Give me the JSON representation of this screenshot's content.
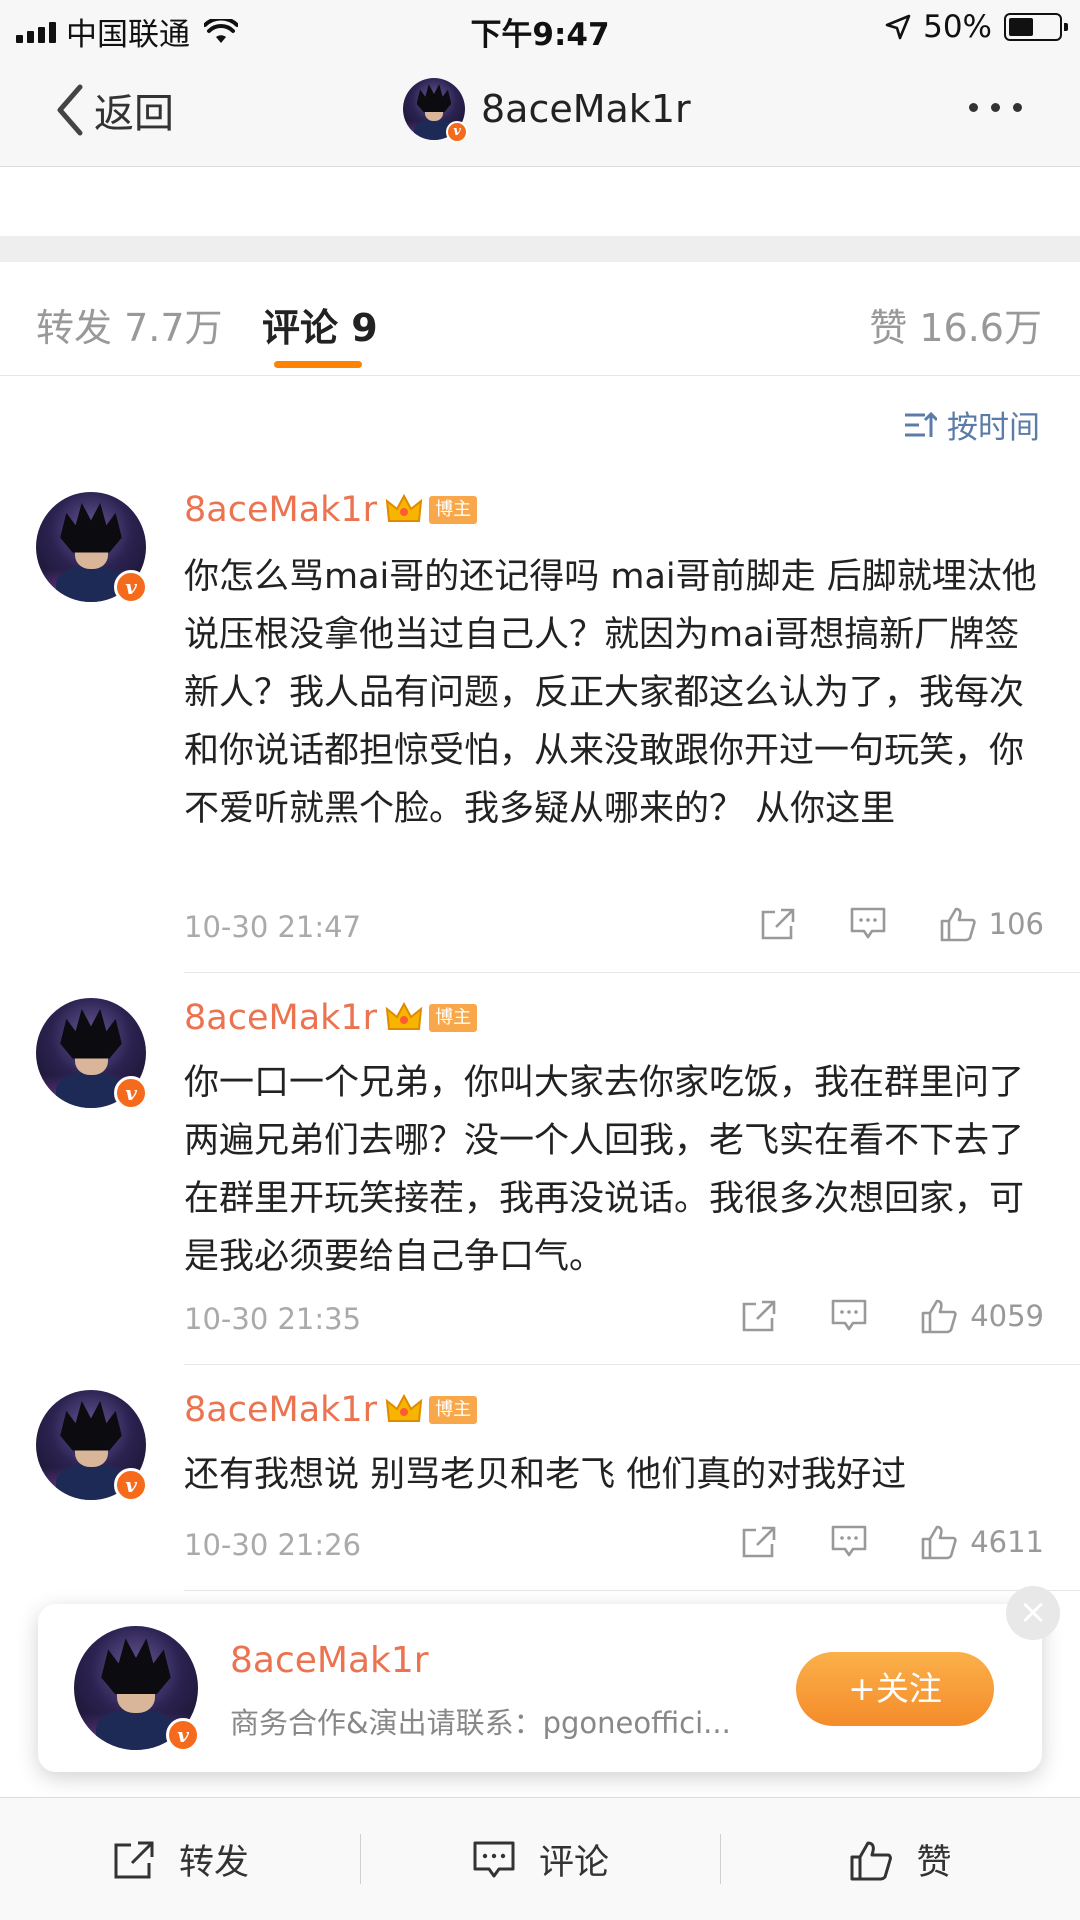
{
  "status_bar": {
    "carrier": "中国联通",
    "time": "下午9:47",
    "battery": "50%",
    "battery_level": 0.5
  },
  "nav": {
    "back_label": "返回",
    "title": "8aceMak1r"
  },
  "tabs": {
    "repost": "转发 7.7万",
    "comment": "评论 9",
    "like": "赞 16.6万"
  },
  "sort_label": "按时间",
  "comments": [
    {
      "name": "8aceMak1r",
      "badge": "博主",
      "text": "你怎么骂mai哥的还记得吗 mai哥前脚走 后脚就埋汰他说压根没拿他当过自己人？就因为mai哥想搞新厂牌签新人？我人品有问题，反正大家都这么认为了，我每次和你说话都担惊受怕，从来没敢跟你开过一句玩笑，你不爱听就黑个脸。我多疑从哪来的？ 从你这里",
      "time": "10-30 21:47",
      "likes": "106"
    },
    {
      "name": "8aceMak1r",
      "badge": "博主",
      "text": "你一口一个兄弟，你叫大家去你家吃饭，我在群里问了两遍兄弟们去哪？没一个人回我，老飞实在看不下去了在群里开玩笑接茬，我再没说话。我很多次想回家，可是我必须要给自己争口气。",
      "time": "10-30 21:35",
      "likes": "4059"
    },
    {
      "name": "8aceMak1r",
      "badge": "博主",
      "text": "还有我想说 别骂老贝和老飞 他们真的对我好过",
      "time": "10-30 21:26",
      "likes": "4611"
    }
  ],
  "follow_card": {
    "name": "8aceMak1r",
    "description": "商务合作&演出请联系：pgoneoffici...",
    "follow_label": "+关注",
    "close_label": "×"
  },
  "bottom_bar": {
    "repost": "转发",
    "comment": "评论",
    "like": "赞"
  },
  "colors": {
    "accent": "#ff8200",
    "name": "#eb7350",
    "link": "#5b7ba8"
  }
}
